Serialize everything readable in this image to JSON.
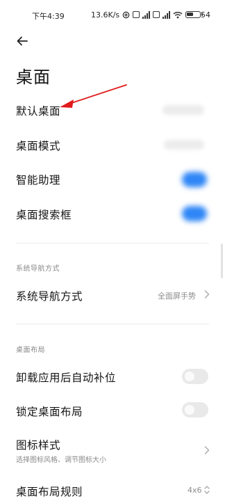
{
  "status_bar": {
    "time": "下午4:39",
    "net_speed": "13.6K/s",
    "battery": "54"
  },
  "header": {
    "title": "桌面"
  },
  "settings": {
    "default_launcher": "默认桌面",
    "launcher_mode": "桌面模式",
    "smart_assistant": "智能助理",
    "search_bar": "桌面搜索框"
  },
  "nav_section": {
    "title": "系统导航方式",
    "item_label": "系统导航方式",
    "item_value": "全面屏手势"
  },
  "layout_section": {
    "title": "桌面布局",
    "auto_fill": "卸载应用后自动补位",
    "lock_layout": "锁定桌面布局",
    "icon_style": "图标样式",
    "icon_style_sub": "选择图标风格、调节图标大小",
    "grid_rule": "桌面布局规则",
    "grid_value": "4x6"
  },
  "toggles": {
    "smart_assistant": true,
    "search_bar": true,
    "auto_fill": false,
    "lock_layout": false
  },
  "colors": {
    "accent": "#2f86f6",
    "annotation": "#e11a1a"
  },
  "icons": [
    "back-arrow-icon",
    "chevron-right-icon",
    "chevron-updown-icon",
    "wifi-icon",
    "battery-icon",
    "signal-icon"
  ]
}
